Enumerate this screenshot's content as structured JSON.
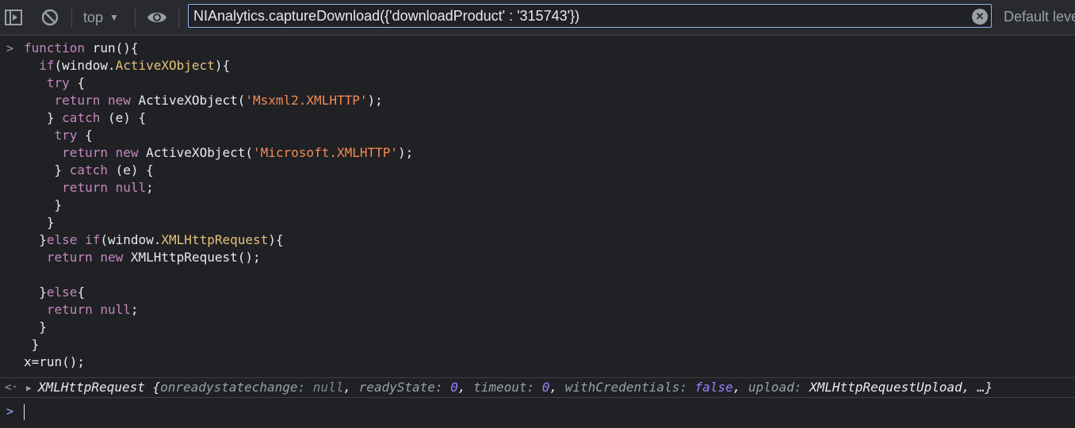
{
  "toolbar": {
    "context_label": "top",
    "filter_value": "NIAnalytics.captureDownload({'downloadProduct' : '315743'})",
    "levels_label": "Default levels"
  },
  "code": {
    "lines": [
      "function run(){",
      "  if(window.ActiveXObject){",
      "   try {",
      "    return new ActiveXObject('Msxml2.XMLHTTP');",
      "   } catch (e) {",
      "    try {",
      "     return new ActiveXObject('Microsoft.XMLHTTP');",
      "    } catch (e) {",
      "     return null;",
      "    }",
      "   }",
      "  }else if(window.XMLHttpRequest){",
      "   return new XMLHttpRequest();",
      "",
      "  }else{",
      "   return null;",
      "  }",
      " }",
      "x=run();"
    ]
  },
  "result": {
    "class_name": "XMLHttpRequest",
    "onreadystatechange_key": "onreadystatechange",
    "onreadystatechange_val": "null",
    "readyState_key": "readyState",
    "readyState_val": "0",
    "timeout_key": "timeout",
    "timeout_val": "0",
    "withCredentials_key": "withCredentials",
    "withCredentials_val": "false",
    "upload_key": "upload",
    "upload_val": "XMLHttpRequestUpload",
    "ellipsis": "…}"
  }
}
